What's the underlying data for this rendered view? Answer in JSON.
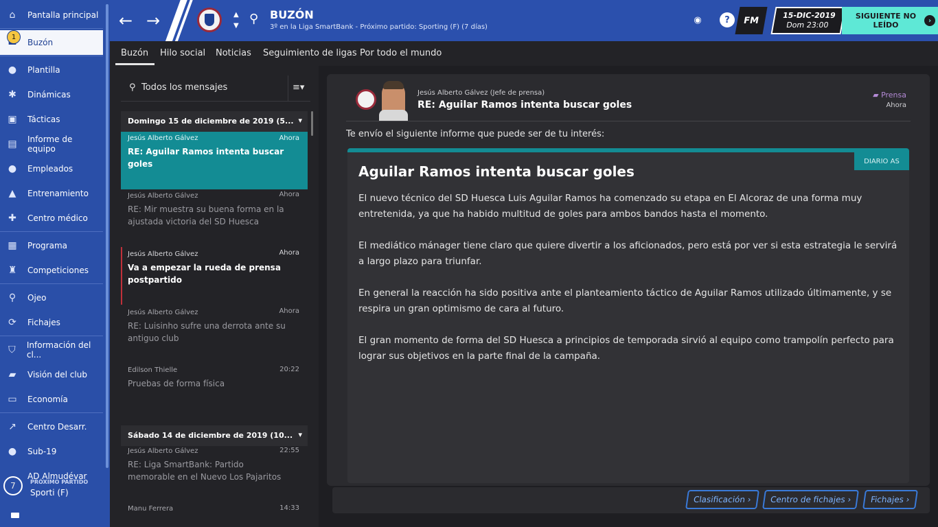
{
  "sidebar": {
    "items": [
      {
        "label": "Pantalla principal",
        "icon": "home-icon"
      },
      {
        "label": "Buzón",
        "icon": "inbox-icon",
        "badge": "1"
      },
      {
        "label": "Plantilla",
        "icon": "squad-icon"
      },
      {
        "label": "Dinámicas",
        "icon": "dynamics-icon"
      },
      {
        "label": "Tácticas",
        "icon": "tactics-icon"
      },
      {
        "label": "Informe de equipo",
        "icon": "report-icon"
      },
      {
        "label": "Empleados",
        "icon": "staff-icon"
      },
      {
        "label": "Entrenamiento",
        "icon": "training-icon"
      },
      {
        "label": "Centro médico",
        "icon": "medical-icon"
      },
      {
        "label": "Programa",
        "icon": "calendar-icon"
      },
      {
        "label": "Competiciones",
        "icon": "trophy-icon"
      },
      {
        "label": "Ojeo",
        "icon": "scouting-icon"
      },
      {
        "label": "Fichajes",
        "icon": "transfers-icon"
      },
      {
        "label": "Información del cl...",
        "icon": "shield-icon"
      },
      {
        "label": "Visión del club",
        "icon": "briefcase-icon"
      },
      {
        "label": "Economía",
        "icon": "finance-icon"
      },
      {
        "label": "Centro Desarr.",
        "icon": "development-icon"
      },
      {
        "label": "Sub-19",
        "icon": "u19-icon"
      }
    ],
    "next_match": {
      "club_label": "AD Almudévar",
      "label": "PRÓXIMO PARTIDO",
      "days": "7",
      "opponent": "Sporti (F)"
    }
  },
  "header": {
    "title": "BUZÓN",
    "subtitle": "3º en la Liga SmartBank - Próximo partido: Sporting (F) (7 días)",
    "help": "?",
    "fm": "FM",
    "date": "15-DIC-2019",
    "time": "Dom 23:00",
    "continue": "SIGUIENTE NO LEÍDO"
  },
  "tabs": [
    "Buzón",
    "Hilo social",
    "Noticias",
    "Seguimiento de ligas",
    "Por todo el mundo"
  ],
  "list": {
    "filter": "Todos los mensajes",
    "group1": "Domingo 15 de diciembre de 2019 (5...",
    "group2": "Sábado 14 de diciembre de 2019 (10...",
    "messages": [
      {
        "from": "Jesús Alberto Gálvez",
        "time": "Ahora",
        "subject": "RE: Aguilar Ramos intenta buscar goles"
      },
      {
        "from": "Jesús Alberto Gálvez",
        "time": "Ahora",
        "subject": "RE: Mir muestra su buena forma en la ajustada victoria del SD Huesca"
      },
      {
        "from": "Jesús Alberto Gálvez",
        "time": "Ahora",
        "subject": "Va a empezar la rueda de prensa postpartido"
      },
      {
        "from": "Jesús Alberto Gálvez",
        "time": "Ahora",
        "subject": "RE: Luisinho sufre una derrota ante su antiguo club"
      },
      {
        "from": "Edilson Thielle",
        "time": "20:22",
        "subject": "Pruebas de forma física"
      },
      {
        "from": "Jesús Alberto Gálvez",
        "time": "22:55",
        "subject": "RE: Liga SmartBank: Partido memorable en el Nuevo Los Pajaritos"
      },
      {
        "from": "Manu Ferrera",
        "time": "14:33",
        "subject": ""
      }
    ]
  },
  "pane": {
    "from": "Jesús Alberto Gálvez  (Jefe de prensa)",
    "subject": "RE: Aguilar Ramos intenta buscar goles",
    "category": "Prensa",
    "time": "Ahora",
    "intro": "Te envío el siguiente informe que puede ser de tu interés:",
    "article": {
      "source": "DIARIO AS",
      "title": "Aguilar Ramos intenta buscar goles",
      "p1": "El nuevo técnico del SD Huesca Luis Aguilar Ramos ha comenzado su etapa en El Alcoraz de una forma muy entretenida, ya que ha habido multitud de goles para ambos bandos hasta el momento.",
      "p2": "El mediático mánager tiene claro que quiere divertir a los aficionados, pero está por ver si esta estrategia le servirá a largo plazo para triunfar.",
      "p3": "En general la reacción ha sido positiva ante el planteamiento táctico de Aguilar Ramos utilizado últimamente, y se respira un gran optimismo de cara al futuro.",
      "p4": "El gran momento de forma del SD Huesca a principios de temporada sirvió al equipo como trampolín perfecto para lograr sus objetivos en la parte final de la campaña."
    }
  },
  "actions": [
    "Clasificación",
    "Centro de fichajes",
    "Fichajes"
  ],
  "colors": {
    "sidebar": "#2a4fa8",
    "accent": "#138c94",
    "continue": "#5ee8d6"
  }
}
